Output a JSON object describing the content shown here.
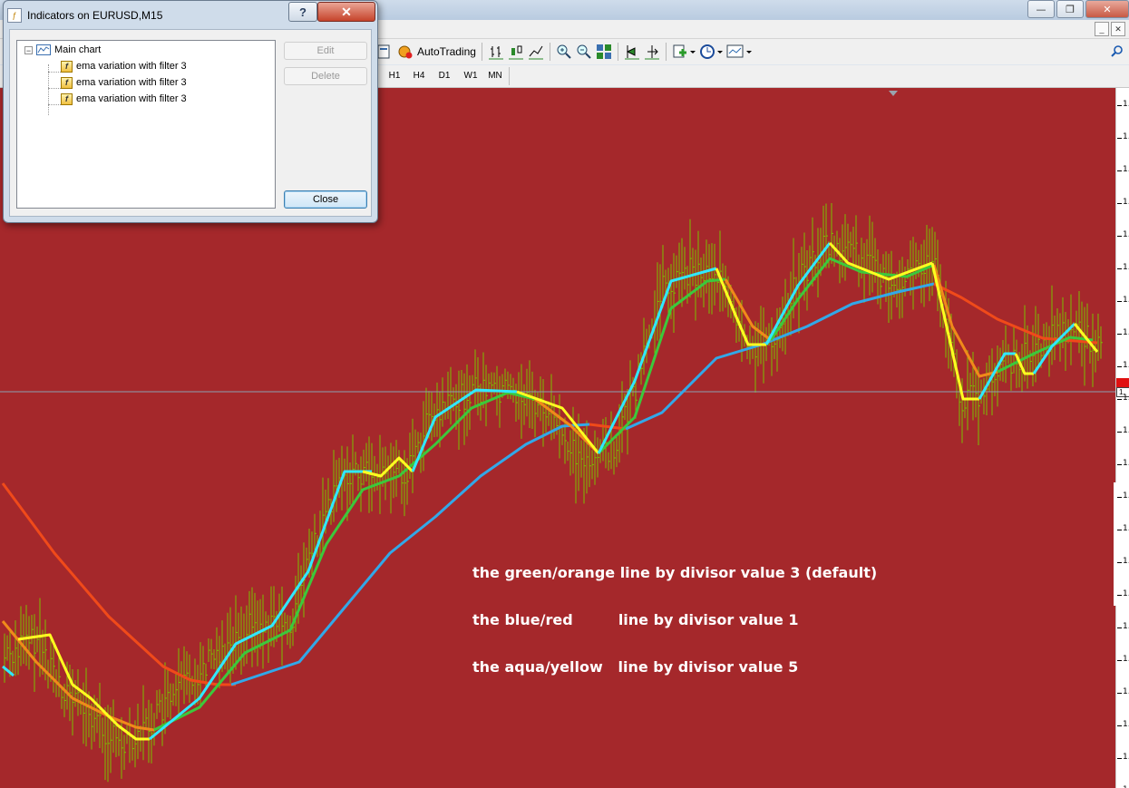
{
  "window": {
    "controls": {
      "minimize": "—",
      "restore": "❐",
      "close": "✕"
    }
  },
  "mdi": {
    "minimize": "_",
    "close": "✕"
  },
  "toolbar": {
    "autotrading_label": "AutoTrading"
  },
  "timeframes": [
    "H1",
    "H4",
    "D1",
    "W1",
    "MN"
  ],
  "dialog": {
    "title": "Indicators on EURUSD,M15",
    "help": "?",
    "close_glyph": "✕",
    "tree": {
      "root": "Main chart",
      "items": [
        "ema variation with filter 3",
        "ema variation with filter 3",
        "ema variation with filter 3"
      ]
    },
    "edit_label": "Edit",
    "delete_label": "Delete",
    "close_label": "Close"
  },
  "chart": {
    "background": "#a5282b",
    "bar_color": "#7cc000",
    "grid_line_color": "#8aa0b0",
    "annotations": [
      "the green/orange line by divisor value 3 (default)",
      "the blue/red         line by divisor value 1",
      "the aqua/yellow   line by divisor value 5"
    ],
    "axis_labels": [
      "1.",
      "1.",
      "1.",
      "1.",
      "1.",
      "1.",
      "1.",
      "1.",
      "1.",
      "1.",
      "1.",
      "1.",
      "1.",
      "1.",
      "1.",
      "1.",
      "1.",
      "1.",
      "1.",
      "1.",
      "1.",
      "1."
    ],
    "bid_label": "1.",
    "lines": {
      "divisor1": {
        "up_color": "#32a8e8",
        "down_color": "#f04a1a"
      },
      "divisor3": {
        "up_color": "#3cc83c",
        "down_color": "#f08a1a"
      },
      "divisor5": {
        "up_color": "#30e8ff",
        "down_color": "#ffff20"
      }
    }
  }
}
